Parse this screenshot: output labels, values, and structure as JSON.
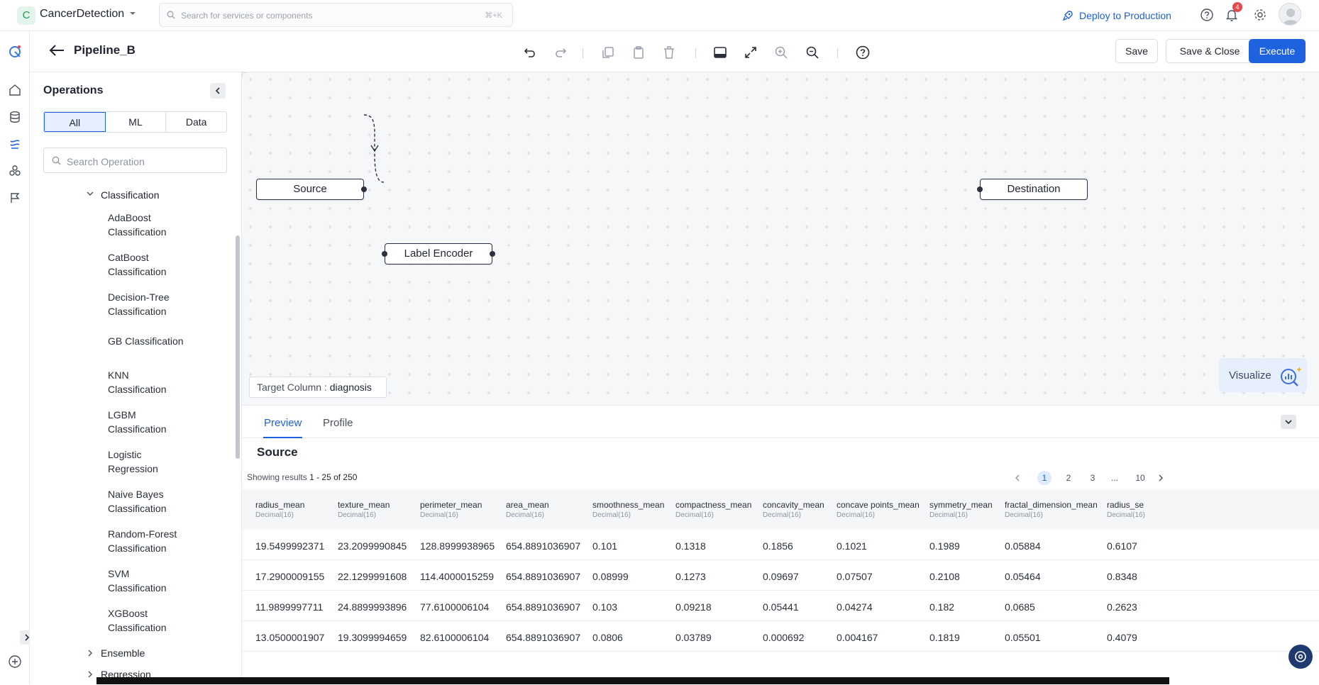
{
  "topbar": {
    "project_initial": "C",
    "project_name": "CancerDetection",
    "search_placeholder": "Search for services or components",
    "search_shortcut": "⌘+K",
    "deploy_label": "Deploy to Production",
    "notification_count": "4"
  },
  "header": {
    "title": "Pipeline_B",
    "save_label": "Save",
    "save_close_label": "Save & Close",
    "execute_label": "Execute"
  },
  "operations": {
    "title": "Operations",
    "filters": [
      "All",
      "ML",
      "Data"
    ],
    "active_filter": "All",
    "search_placeholder": "Search Operation",
    "categories": [
      {
        "label": "Classification",
        "expanded": true,
        "items": [
          [
            "AdaBoost",
            "Classification"
          ],
          [
            "CatBoost",
            "Classification"
          ],
          [
            "Decision-Tree",
            "Classification"
          ],
          [
            "GB Classification"
          ],
          [
            "KNN",
            "Classification"
          ],
          [
            "LGBM",
            "Classification"
          ],
          [
            "Logistic",
            "Regression"
          ],
          [
            "Naive Bayes",
            "Classification"
          ],
          [
            "Random-Forest",
            "Classification"
          ],
          [
            "SVM",
            "Classification"
          ],
          [
            "XGBoost",
            "Classification"
          ]
        ]
      },
      {
        "label": "Ensemble",
        "expanded": false,
        "items": []
      },
      {
        "label": "Regression",
        "expanded": false,
        "items": []
      }
    ]
  },
  "canvas": {
    "nodes": {
      "source": "Source",
      "destination": "Destination",
      "label_encoder": "Label Encoder"
    },
    "target_label": "Target Column :",
    "target_value": "diagnosis",
    "visualize_label": "Visualize"
  },
  "panel": {
    "tabs": [
      "Preview",
      "Profile"
    ],
    "active_tab": "Preview",
    "source_title": "Source",
    "results_prefix": "Showing results",
    "results_range": "1 - 25 of 250",
    "pages": [
      "1",
      "2",
      "3",
      "...",
      "10"
    ],
    "active_page": "1",
    "columns": [
      {
        "name": "radius_mean",
        "type": "Decimal(16)"
      },
      {
        "name": "texture_mean",
        "type": "Decimal(16)"
      },
      {
        "name": "perimeter_mean",
        "type": "Decimal(16)"
      },
      {
        "name": "area_mean",
        "type": "Decimal(16)"
      },
      {
        "name": "smoothness_mean",
        "type": "Decimal(16)"
      },
      {
        "name": "compactness_mean",
        "type": "Decimal(16)"
      },
      {
        "name": "concavity_mean",
        "type": "Decimal(16)"
      },
      {
        "name": "concave points_mean",
        "type": "Decimal(16)"
      },
      {
        "name": "symmetry_mean",
        "type": "Decimal(16)"
      },
      {
        "name": "fractal_dimension_mean",
        "type": "Decimal(16)"
      },
      {
        "name": "radius_se",
        "type": "Decimal(16)"
      }
    ],
    "rows": [
      [
        "19.5499992371",
        "23.2099990845",
        "128.8999938965",
        "654.8891036907",
        "0.101",
        "0.1318",
        "0.1856",
        "0.1021",
        "0.1989",
        "0.05884",
        "0.6107"
      ],
      [
        "17.2900009155",
        "22.1299991608",
        "114.4000015259",
        "654.8891036907",
        "0.08999",
        "0.1273",
        "0.09697",
        "0.07507",
        "0.2108",
        "0.05464",
        "0.8348"
      ],
      [
        "11.9899997711",
        "24.8899993896",
        "77.6100006104",
        "654.8891036907",
        "0.103",
        "0.09218",
        "0.05441",
        "0.04274",
        "0.182",
        "0.0685",
        "0.2623"
      ],
      [
        "13.0500001907",
        "19.3099994659",
        "82.6100006104",
        "654.8891036907",
        "0.0806",
        "0.03789",
        "0.000692",
        "0.004167",
        "0.1819",
        "0.05501",
        "0.4079"
      ]
    ]
  },
  "colors": {
    "accent": "#1f62e0",
    "node_border": "#2b3140",
    "canvas_bg": "#f6f7f9"
  }
}
